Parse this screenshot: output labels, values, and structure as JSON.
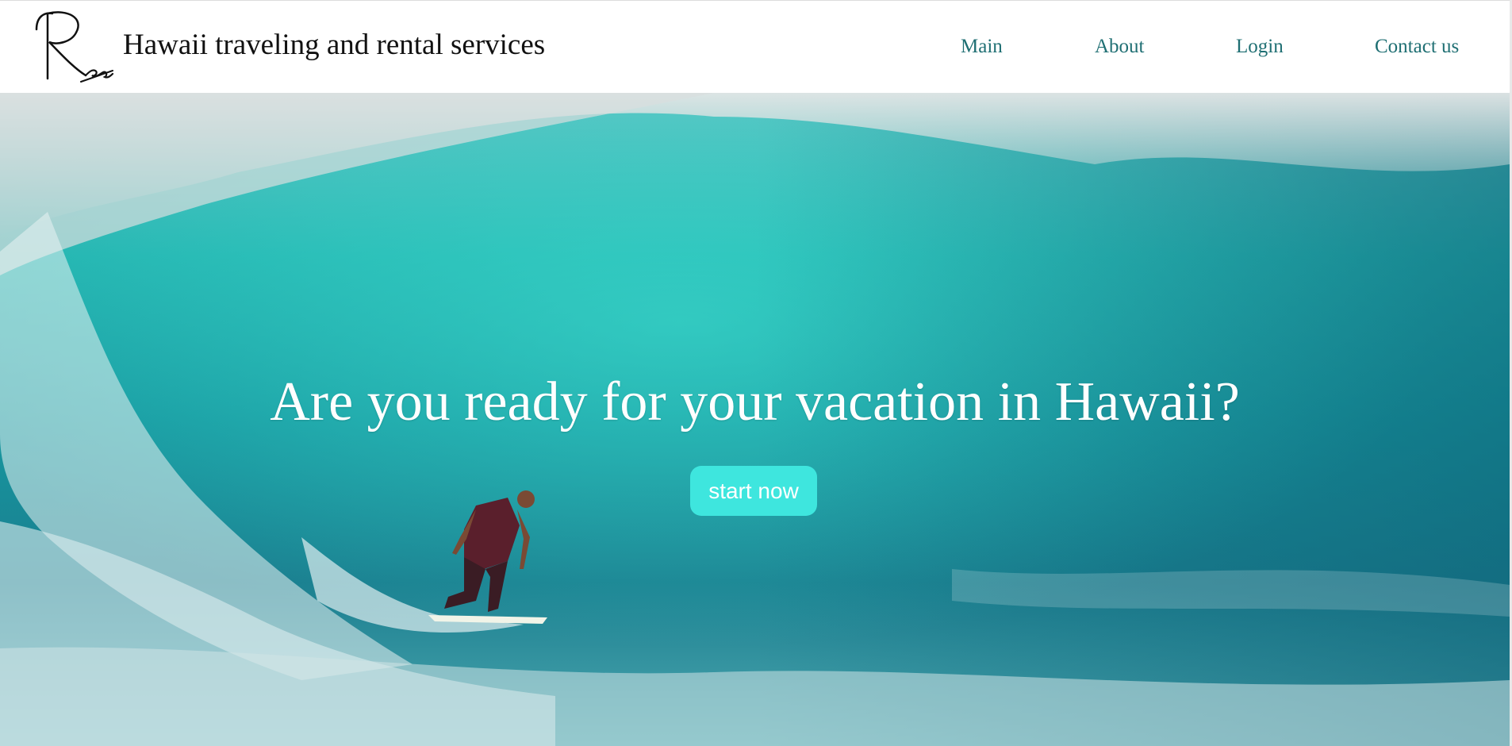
{
  "header": {
    "logo_icon": "signature-logo",
    "site_title": "Hawaii traveling and rental services"
  },
  "nav": {
    "items": [
      {
        "label": "Main"
      },
      {
        "label": "About"
      },
      {
        "label": "Login"
      },
      {
        "label": "Contact us"
      }
    ]
  },
  "hero": {
    "image": "surfer-riding-turquoise-wave",
    "headline": "Are you ready for your vacation in Hawaii?",
    "cta_label": "start now"
  },
  "colors": {
    "nav_link": "#1f6f73",
    "cta_background": "#3ee6de",
    "cta_text": "#ffffff",
    "headline": "#ffffff"
  }
}
